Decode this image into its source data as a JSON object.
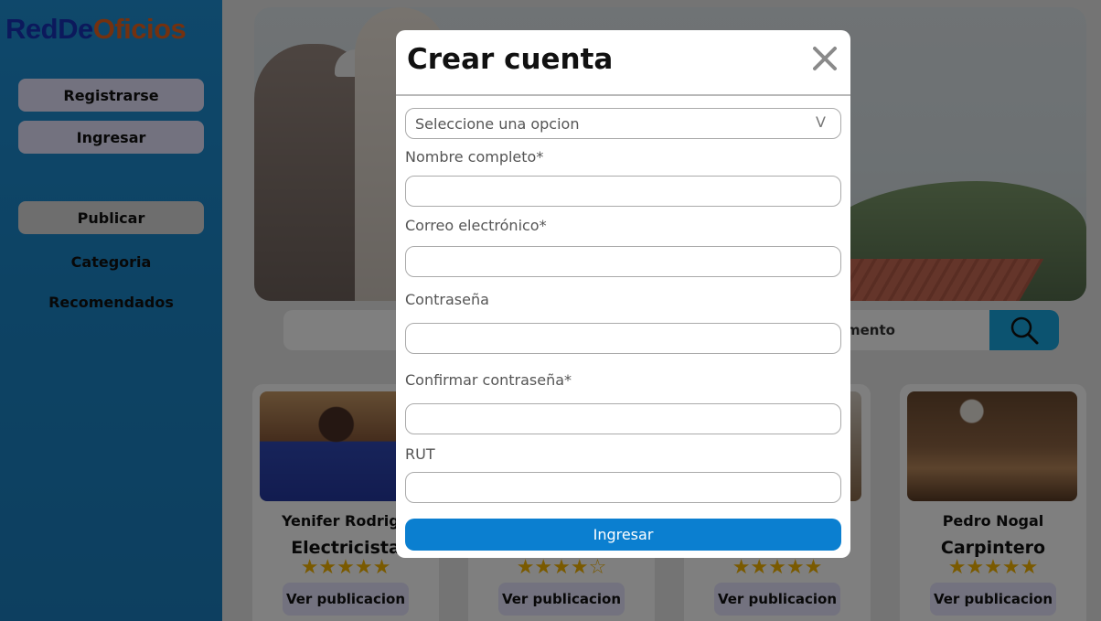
{
  "brand": {
    "logo_part1": "RedDe",
    "logo_part2": "Oficios"
  },
  "sidebar": {
    "register_label": "Registrarse",
    "login_label": "Ingresar",
    "publish_label": "Publicar",
    "category_label": "Categoria",
    "recommended_label": "Recomendados"
  },
  "search": {
    "partial_placeholder": "mento"
  },
  "cards": [
    {
      "name": "Yenifer Rodrigu",
      "role": "Electricista",
      "stars": "★★★★★",
      "button": "Ver publicacion"
    },
    {
      "name": "",
      "role": "",
      "stars": "★★★★☆",
      "button": "Ver publicacion"
    },
    {
      "name": "",
      "role": "",
      "stars": "★★★★★",
      "button": "Ver publicacion"
    },
    {
      "name": "Pedro Nogal",
      "role": "Carpintero",
      "stars": "★★★★★",
      "button": "Ver publicacion"
    }
  ],
  "modal": {
    "title": "Crear cuenta",
    "select_value": "Seleccione una opcion",
    "select_chevron": "V",
    "fields": [
      {
        "label": "Nombre completo*"
      },
      {
        "label": "Correo electrónico*"
      },
      {
        "label": "Contraseña"
      },
      {
        "label": "Confirmar contraseña*"
      },
      {
        "label": "RUT"
      }
    ],
    "submit_label": "Ingresar"
  },
  "colors": {
    "sidebar_blue": "#1e90d6",
    "logo_blue": "#1833b8",
    "logo_orange": "#e8631f",
    "button_lavender": "#e6e4ff",
    "search_button": "#18a7e0",
    "submit_blue": "#0b7fd0",
    "star_gold": "#f4b400"
  }
}
